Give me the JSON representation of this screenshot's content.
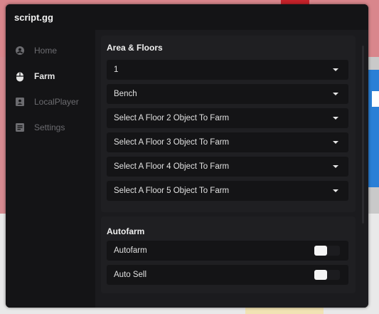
{
  "window": {
    "title": "script.gg"
  },
  "sidebar": {
    "items": [
      {
        "label": "Home",
        "icon": "user-circle-icon",
        "active": false
      },
      {
        "label": "Farm",
        "icon": "mouse-icon",
        "active": true
      },
      {
        "label": "LocalPlayer",
        "icon": "id-card-icon",
        "active": false
      },
      {
        "label": "Settings",
        "icon": "settings-doc-icon",
        "active": false
      }
    ]
  },
  "area_floors": {
    "title": "Area & Floors",
    "dropdowns": [
      {
        "value": "1"
      },
      {
        "value": "Bench"
      },
      {
        "value": "Select A Floor 2 Object To Farm"
      },
      {
        "value": "Select A Floor 3 Object To Farm"
      },
      {
        "value": "Select A Floor 4 Object To Farm"
      },
      {
        "value": "Select A Floor 5 Object To Farm"
      }
    ]
  },
  "autofarm": {
    "title": "Autofarm",
    "toggles": [
      {
        "label": "Autofarm",
        "state": "off"
      },
      {
        "label": "Auto Sell",
        "state": "off"
      }
    ]
  },
  "colors": {
    "window_bg": "#141416",
    "content_bg": "#1b1b1e",
    "text_primary": "#f0f0f0",
    "text_muted": "#6c6c70"
  }
}
